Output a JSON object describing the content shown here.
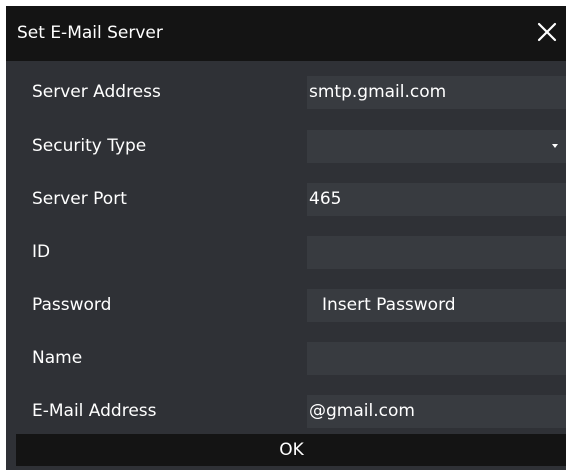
{
  "dialog": {
    "title": "Set E-Mail Server",
    "close_icon": "close-icon"
  },
  "fields": {
    "server_address": {
      "label": "Server Address",
      "value": "smtp.gmail.com"
    },
    "security_type": {
      "label": "Security Type",
      "value": "",
      "icon": "dropdown-arrow-icon"
    },
    "server_port": {
      "label": "Server Port",
      "value": "465"
    },
    "id": {
      "label": "ID",
      "value": ""
    },
    "password": {
      "label": "Password",
      "value": "Insert Password"
    },
    "name": {
      "label": "Name",
      "value": ""
    },
    "email_address": {
      "label": "E-Mail Address",
      "value": "@gmail.com"
    }
  },
  "buttons": {
    "ok_label": "OK"
  },
  "colors": {
    "title_bar": "#141414",
    "dialog_bg": "#2f3136",
    "field_bg": "#383b40",
    "text": "#ffffff"
  }
}
